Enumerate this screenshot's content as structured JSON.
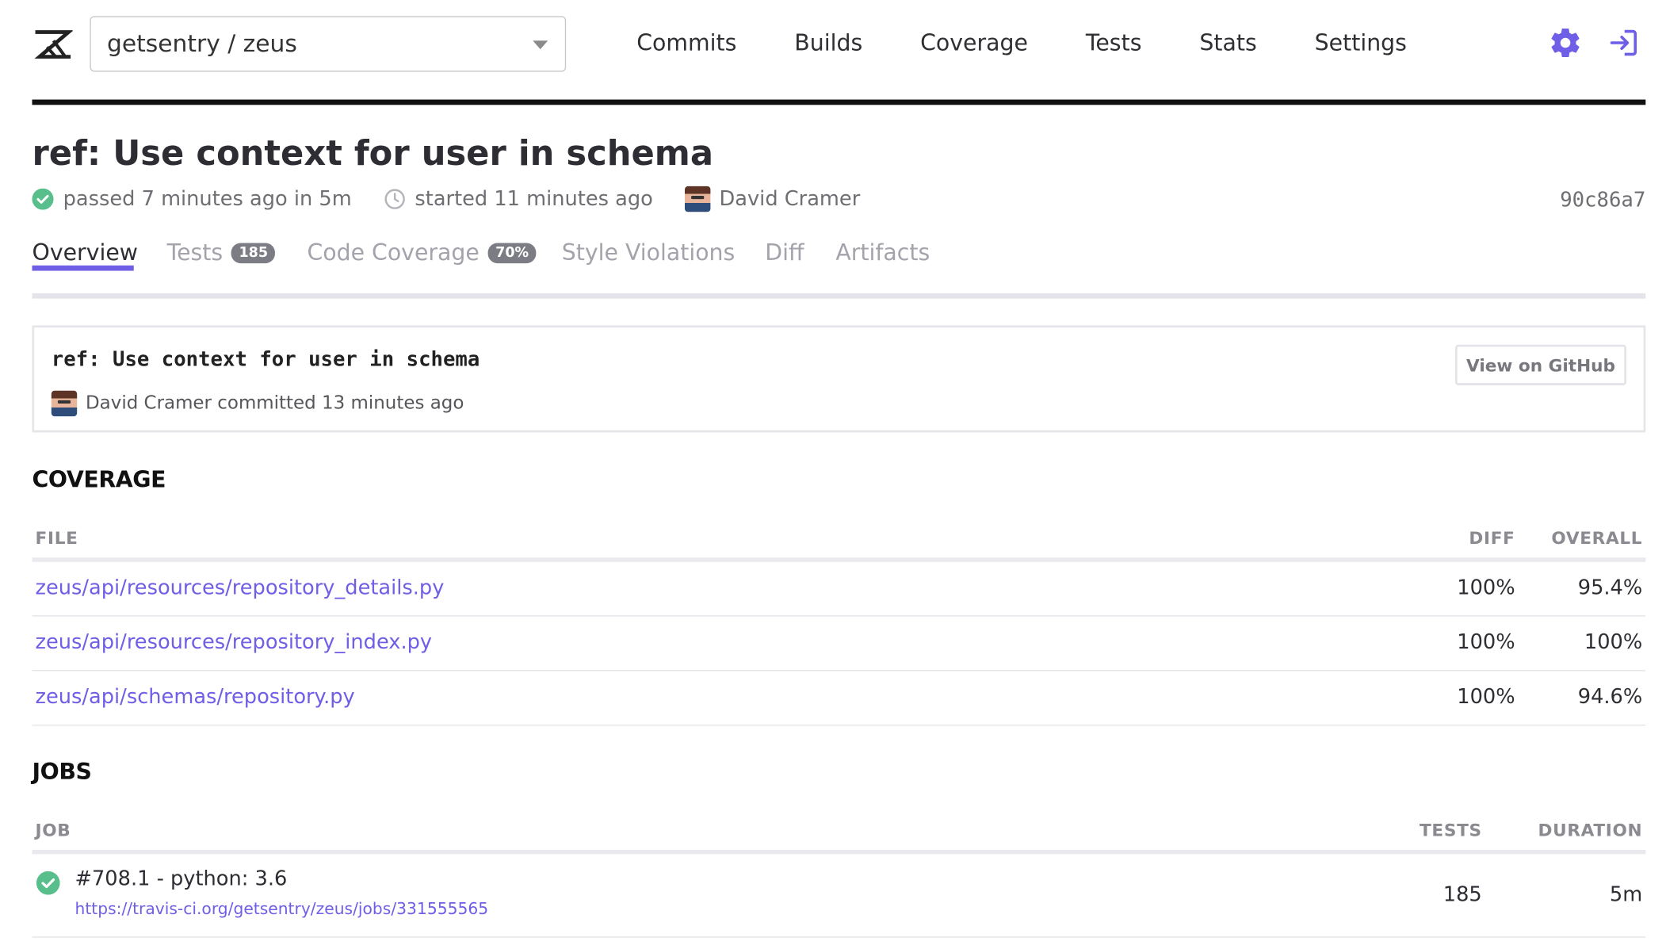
{
  "header": {
    "repo": "getsentry / zeus",
    "nav": [
      "Commits",
      "Builds",
      "Coverage",
      "Tests",
      "Stats",
      "Settings"
    ],
    "icons": {
      "logo": "zeus-logo-icon",
      "settings": "gear-icon",
      "logout": "logout-icon"
    },
    "accent_color": "#6f5ee6"
  },
  "build": {
    "title": "ref: Use context for user in schema",
    "status_text": "passed 7 minutes ago in 5m",
    "started_text": "started 11 minutes ago",
    "author": "David Cramer",
    "sha": "90c86a7"
  },
  "tabs": [
    {
      "label": "Overview",
      "badge": null,
      "active": true
    },
    {
      "label": "Tests",
      "badge": "185",
      "active": false
    },
    {
      "label": "Code Coverage",
      "badge": "70%",
      "active": false
    },
    {
      "label": "Style Violations",
      "badge": null,
      "active": false
    },
    {
      "label": "Diff",
      "badge": null,
      "active": false
    },
    {
      "label": "Artifacts",
      "badge": null,
      "active": false
    }
  ],
  "commit": {
    "message": "ref: Use context for user in schema",
    "byline": "David Cramer committed 13 minutes ago",
    "github_button": "View on GitHub"
  },
  "coverage": {
    "heading": "COVERAGE",
    "columns": {
      "file": "FILE",
      "diff": "DIFF",
      "overall": "OVERALL"
    },
    "rows": [
      {
        "file": "zeus/api/resources/repository_details.py",
        "diff": "100%",
        "overall": "95.4%"
      },
      {
        "file": "zeus/api/resources/repository_index.py",
        "diff": "100%",
        "overall": "100%"
      },
      {
        "file": "zeus/api/schemas/repository.py",
        "diff": "100%",
        "overall": "94.6%"
      }
    ]
  },
  "jobs": {
    "heading": "JOBS",
    "columns": {
      "job": "JOB",
      "tests": "TESTS",
      "duration": "DURATION"
    },
    "rows": [
      {
        "title": "#708.1 - python: 3.6",
        "url": "https://travis-ci.org/getsentry/zeus/jobs/331555565",
        "tests": "185",
        "duration": "5m",
        "status": "passed"
      }
    ]
  }
}
